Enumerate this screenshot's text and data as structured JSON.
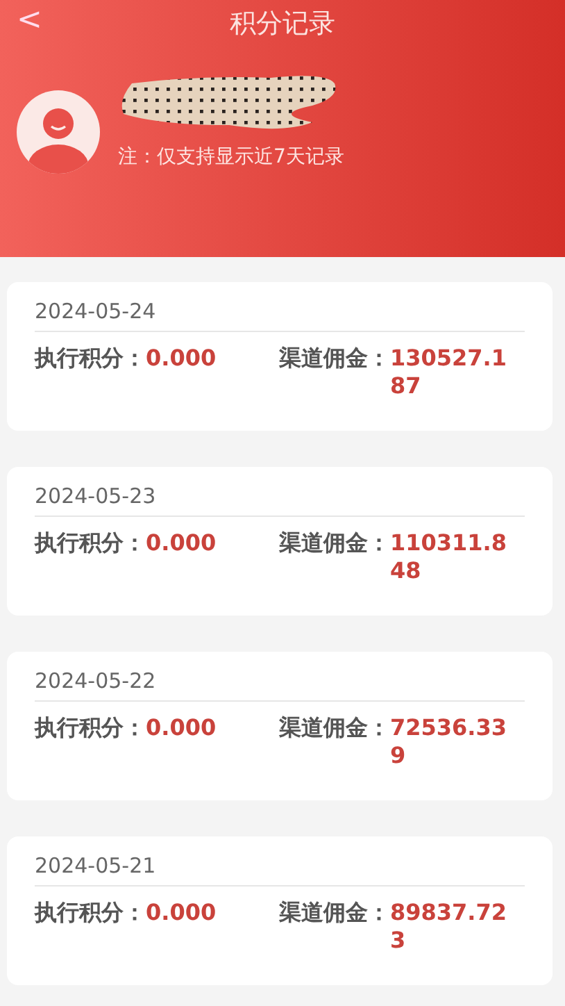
{
  "header": {
    "back": "<",
    "title": "积分记录",
    "note": "注：仅支持显示近7天记录"
  },
  "records": [
    {
      "date": "2024-05-24",
      "exec_label": "执行积分：",
      "exec_value": "0.000",
      "channel_label": "渠道佣金：",
      "channel_value": "130527.187"
    },
    {
      "date": "2024-05-23",
      "exec_label": "执行积分：",
      "exec_value": "0.000",
      "channel_label": "渠道佣金：",
      "channel_value": "110311.848"
    },
    {
      "date": "2024-05-22",
      "exec_label": "执行积分：",
      "exec_value": "0.000",
      "channel_label": "渠道佣金：",
      "channel_value": "72536.339"
    },
    {
      "date": "2024-05-21",
      "exec_label": "执行积分：",
      "exec_value": "0.000",
      "channel_label": "渠道佣金：",
      "channel_value": "89837.723"
    }
  ]
}
